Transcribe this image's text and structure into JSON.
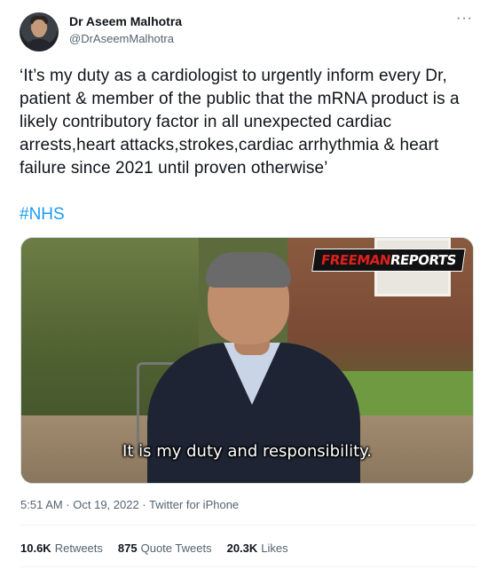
{
  "author": {
    "name": "Dr Aseem Malhotra",
    "handle": "@DrAseemMalhotra"
  },
  "menu_icon": "more-dots-icon",
  "menu_glyph": "···",
  "tweet": {
    "text": "‘It’s my duty as a cardiologist to urgently inform every Dr, patient & member of the public that the mRNA product is a likely contributory factor in all unexpected cardiac arrests,heart attacks,strokes,cardiac arrhythmia & heart failure since 2021 until proven otherwise’",
    "hashtag": "#NHS"
  },
  "media": {
    "logo_left": "FREEMAN",
    "logo_right": "REPORTS",
    "caption": "It is my duty and responsibility."
  },
  "meta": {
    "timestamp": "5:51 AM · Oct 19, 2022 · Twitter for iPhone"
  },
  "stats": [
    {
      "value": "10.6K",
      "label": "Retweets"
    },
    {
      "value": "875",
      "label": "Quote Tweets"
    },
    {
      "value": "20.3K",
      "label": "Likes"
    }
  ],
  "colors": {
    "link": "#1d9bf0",
    "secondary_text": "#536471",
    "primary_text": "#0f1419",
    "logo_accent": "#e0201f"
  }
}
